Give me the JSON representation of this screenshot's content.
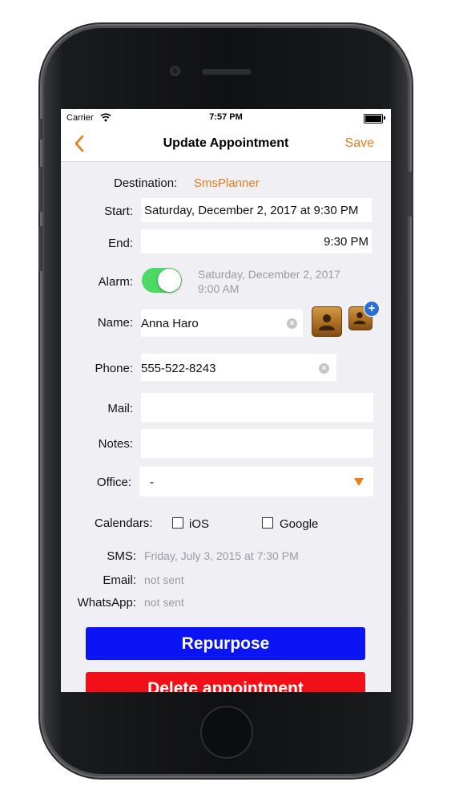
{
  "status_bar": {
    "carrier": "Carrier",
    "time": "7:57 PM"
  },
  "nav": {
    "title": "Update Appointment",
    "save_label": "Save",
    "back_icon": "chevron-left-icon"
  },
  "colors": {
    "accent": "#ef7b1a",
    "toggle_on": "#4cd964",
    "repurpose": "#0a14f5",
    "delete": "#f21018"
  },
  "form": {
    "destination_label": "Destination:",
    "destination_value": "SmsPlanner",
    "start_label": "Start:",
    "start_value": "Saturday, December 2, 2017 at 9:30 PM",
    "end_label": "End:",
    "end_value": "9:30 PM",
    "alarm_label": "Alarm:",
    "alarm_on": true,
    "alarm_date": "Saturday, December 2, 2017",
    "alarm_time": "9:00 AM",
    "name_label": "Name:",
    "name_value": "Anna Haro",
    "phone_label": "Phone:",
    "phone_value": "555-522-8243",
    "mail_label": "Mail:",
    "mail_value": "",
    "notes_label": "Notes:",
    "notes_value": "",
    "office_label": "Office:",
    "office_value": "-",
    "calendars_label": "Calendars:",
    "calendar_ios": "iOS",
    "calendar_google": "Google"
  },
  "sent_status": {
    "sms_label": "SMS:",
    "sms_value": "Friday, July 3, 2015 at 7:30 PM",
    "email_label": "Email:",
    "email_value": "not sent",
    "whatsapp_label": "WhatsApp:",
    "whatsapp_value": "not sent"
  },
  "actions": {
    "repurpose_label": "Repurpose",
    "delete_label": "Delete appointment"
  }
}
